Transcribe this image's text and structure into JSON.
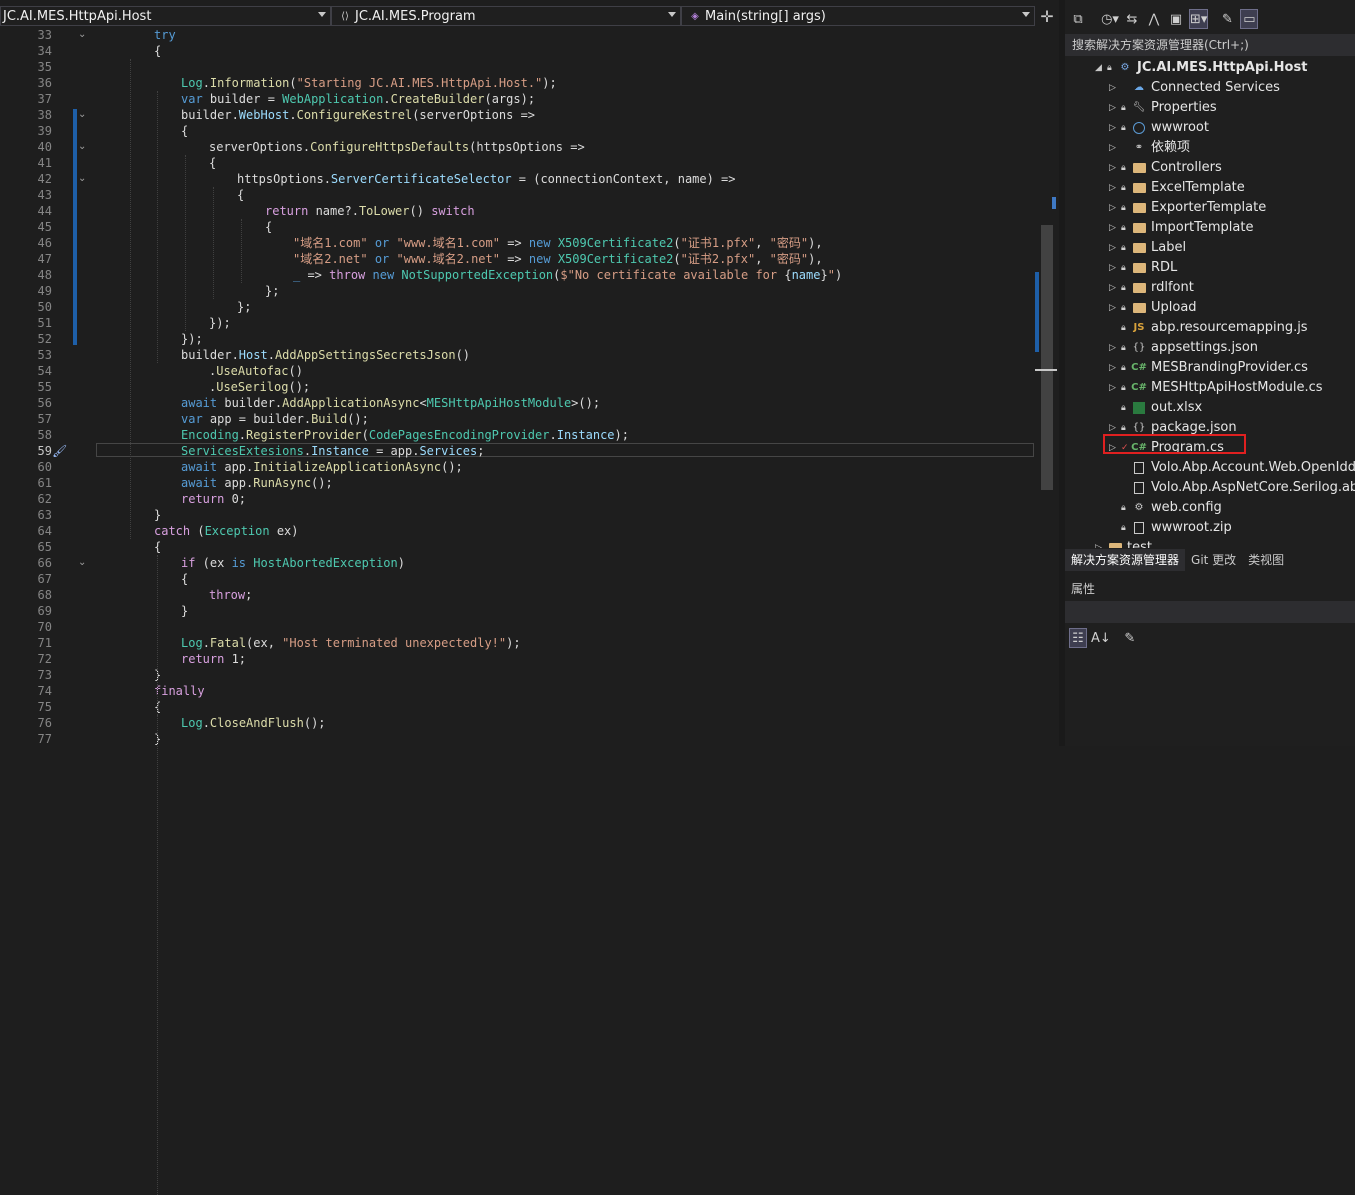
{
  "navbar": {
    "project": "JC.AI.MES.HttpApi.Host",
    "type": "JC.AI.MES.Program",
    "member": "Main(string[] args)",
    "type_icon": "class-icon",
    "member_icon": "method-icon"
  },
  "editor": {
    "current_line": 59,
    "lines": [
      {
        "n": 33,
        "t": [
          [
            "kw",
            "try"
          ]
        ],
        "ind": 54,
        "fold": "v"
      },
      {
        "n": 34,
        "t": [
          [
            "",
            "{"
          ]
        ],
        "ind": 54
      },
      {
        "n": 35,
        "t": [
          [
            "",
            ""
          ]
        ],
        "ind": 54
      },
      {
        "n": 36,
        "t": [
          [
            "ty",
            "Log"
          ],
          [
            "",
            "."
          ],
          [
            "mt",
            "Information"
          ],
          [
            "",
            "("
          ],
          [
            "st",
            "\"Starting JC.AI.MES.HttpApi.Host.\""
          ],
          [
            "",
            ");"
          ]
        ],
        "ind": 81
      },
      {
        "n": 37,
        "t": [
          [
            "kw",
            "var"
          ],
          [
            "",
            " builder = "
          ],
          [
            "ty",
            "WebApplication"
          ],
          [
            "",
            "."
          ],
          [
            "mt",
            "CreateBuilder"
          ],
          [
            "",
            "(args);"
          ]
        ],
        "ind": 81
      },
      {
        "n": 38,
        "t": [
          [
            "",
            "builder."
          ],
          [
            "pr",
            "WebHost"
          ],
          [
            "",
            "."
          ],
          [
            "mt",
            "ConfigureKestrel"
          ],
          [
            "",
            "(serverOptions =>"
          ]
        ],
        "ind": 81,
        "fold": "v"
      },
      {
        "n": 39,
        "t": [
          [
            "",
            "{"
          ]
        ],
        "ind": 81
      },
      {
        "n": 40,
        "t": [
          [
            "",
            "serverOptions."
          ],
          [
            "mt",
            "ConfigureHttpsDefaults"
          ],
          [
            "",
            "(httpsOptions =>"
          ]
        ],
        "ind": 109,
        "fold": "v"
      },
      {
        "n": 41,
        "t": [
          [
            "",
            "{"
          ]
        ],
        "ind": 109
      },
      {
        "n": 42,
        "t": [
          [
            "",
            "httpsOptions."
          ],
          [
            "pr",
            "ServerCertificateSelector"
          ],
          [
            "",
            " = (connectionContext, name) =>"
          ]
        ],
        "ind": 137,
        "fold": "v"
      },
      {
        "n": 43,
        "t": [
          [
            "",
            "{"
          ]
        ],
        "ind": 137
      },
      {
        "n": 44,
        "t": [
          [
            "pl",
            "return"
          ],
          [
            "",
            " name?."
          ],
          [
            "mt",
            "ToLower"
          ],
          [
            "",
            "() "
          ],
          [
            "pl",
            "switch"
          ]
        ],
        "ind": 165
      },
      {
        "n": 45,
        "t": [
          [
            "",
            "{"
          ]
        ],
        "ind": 165
      },
      {
        "n": 46,
        "t": [
          [
            "st",
            "\"域名1.com\""
          ],
          [
            "",
            " "
          ],
          [
            "kw",
            "or"
          ],
          [
            "",
            " "
          ],
          [
            "st",
            "\"www.域名1.com\""
          ],
          [
            "",
            " => "
          ],
          [
            "kw",
            "new"
          ],
          [
            "",
            " "
          ],
          [
            "ty",
            "X509Certificate2"
          ],
          [
            "",
            "("
          ],
          [
            "st",
            "\"证书1.pfx\""
          ],
          [
            "",
            ", "
          ],
          [
            "st",
            "\"密码\""
          ],
          [
            "",
            "),"
          ]
        ],
        "ind": 193
      },
      {
        "n": 47,
        "t": [
          [
            "st",
            "\"域名2.net\""
          ],
          [
            "",
            " "
          ],
          [
            "kw",
            "or"
          ],
          [
            "",
            " "
          ],
          [
            "st",
            "\"www.域名2.net\""
          ],
          [
            "",
            " => "
          ],
          [
            "kw",
            "new"
          ],
          [
            "",
            " "
          ],
          [
            "ty",
            "X509Certificate2"
          ],
          [
            "",
            "("
          ],
          [
            "st",
            "\"证书2.pfx\""
          ],
          [
            "",
            ", "
          ],
          [
            "st",
            "\"密码\""
          ],
          [
            "",
            "),"
          ]
        ],
        "ind": 193
      },
      {
        "n": 48,
        "t": [
          [
            "kw",
            "_"
          ],
          [
            "",
            " => "
          ],
          [
            "pl",
            "throw"
          ],
          [
            "",
            " "
          ],
          [
            "kw",
            "new"
          ],
          [
            "",
            " "
          ],
          [
            "ty",
            "NotSupportedException"
          ],
          [
            "",
            "("
          ],
          [
            "st",
            "$\"No certificate available for "
          ],
          [
            "",
            "{"
          ],
          [
            "pr",
            "name"
          ],
          [
            "",
            "}"
          ],
          [
            "st",
            "\""
          ],
          [
            "",
            ")"
          ]
        ],
        "ind": 193
      },
      {
        "n": 49,
        "t": [
          [
            "",
            "};"
          ]
        ],
        "ind": 165
      },
      {
        "n": 50,
        "t": [
          [
            "",
            "};"
          ]
        ],
        "ind": 137
      },
      {
        "n": 51,
        "t": [
          [
            "",
            "});"
          ]
        ],
        "ind": 109
      },
      {
        "n": 52,
        "t": [
          [
            "",
            "});"
          ]
        ],
        "ind": 81
      },
      {
        "n": 53,
        "t": [
          [
            "",
            "builder."
          ],
          [
            "pr",
            "Host"
          ],
          [
            "",
            "."
          ],
          [
            "mt",
            "AddAppSettingsSecretsJson"
          ],
          [
            "",
            "()"
          ]
        ],
        "ind": 81
      },
      {
        "n": 54,
        "t": [
          [
            "",
            "."
          ],
          [
            "mt",
            "UseAutofac"
          ],
          [
            "",
            "()"
          ]
        ],
        "ind": 109
      },
      {
        "n": 55,
        "t": [
          [
            "",
            "."
          ],
          [
            "mt",
            "UseSerilog"
          ],
          [
            "",
            "();"
          ]
        ],
        "ind": 109
      },
      {
        "n": 56,
        "t": [
          [
            "kw",
            "await"
          ],
          [
            "",
            " builder."
          ],
          [
            "mt",
            "AddApplicationAsync"
          ],
          [
            "",
            "<"
          ],
          [
            "ty",
            "MESHttpApiHostModule"
          ],
          [
            "",
            ">();"
          ]
        ],
        "ind": 81
      },
      {
        "n": 57,
        "t": [
          [
            "kw",
            "var"
          ],
          [
            "",
            " app = builder."
          ],
          [
            "mt",
            "Build"
          ],
          [
            "",
            "();"
          ]
        ],
        "ind": 81
      },
      {
        "n": 58,
        "t": [
          [
            "ty",
            "Encoding"
          ],
          [
            "",
            "."
          ],
          [
            "mt",
            "RegisterProvider"
          ],
          [
            "",
            "("
          ],
          [
            "ty",
            "CodePagesEncodingProvider"
          ],
          [
            "",
            "."
          ],
          [
            "pr",
            "Instance"
          ],
          [
            "",
            ");"
          ]
        ],
        "ind": 81
      },
      {
        "n": 59,
        "t": [
          [
            "ty",
            "ServicesExtesions"
          ],
          [
            "",
            "."
          ],
          [
            "pr",
            "Instance"
          ],
          [
            "",
            " = app."
          ],
          [
            "pr",
            "Services"
          ],
          [
            "",
            ";"
          ]
        ],
        "ind": 81
      },
      {
        "n": 60,
        "t": [
          [
            "kw",
            "await"
          ],
          [
            "",
            " app."
          ],
          [
            "mt",
            "InitializeApplicationAsync"
          ],
          [
            "",
            "();"
          ]
        ],
        "ind": 81
      },
      {
        "n": 61,
        "t": [
          [
            "kw",
            "await"
          ],
          [
            "",
            " app."
          ],
          [
            "mt",
            "RunAsync"
          ],
          [
            "",
            "();"
          ]
        ],
        "ind": 81
      },
      {
        "n": 62,
        "t": [
          [
            "pl",
            "return"
          ],
          [
            "",
            " 0;"
          ]
        ],
        "ind": 81
      },
      {
        "n": 63,
        "t": [
          [
            "",
            "}"
          ]
        ],
        "ind": 54
      },
      {
        "n": 64,
        "t": [
          [
            "pl",
            "catch"
          ],
          [
            "",
            " ("
          ],
          [
            "ty",
            "Exception"
          ],
          [
            "",
            " ex)"
          ]
        ],
        "ind": 54
      },
      {
        "n": 65,
        "t": [
          [
            "",
            "{"
          ]
        ],
        "ind": 54
      },
      {
        "n": 66,
        "t": [
          [
            "pl",
            "if"
          ],
          [
            "",
            " (ex "
          ],
          [
            "kw",
            "is"
          ],
          [
            "",
            " "
          ],
          [
            "ty",
            "HostAbortedException"
          ],
          [
            "",
            ")"
          ]
        ],
        "ind": 81,
        "fold": "v"
      },
      {
        "n": 67,
        "t": [
          [
            "",
            "{"
          ]
        ],
        "ind": 81
      },
      {
        "n": 68,
        "t": [
          [
            "pl",
            "throw"
          ],
          [
            "",
            ";"
          ]
        ],
        "ind": 109
      },
      {
        "n": 69,
        "t": [
          [
            "",
            "}"
          ]
        ],
        "ind": 81
      },
      {
        "n": 70,
        "t": [
          [
            "",
            ""
          ]
        ],
        "ind": 81
      },
      {
        "n": 71,
        "t": [
          [
            "ty",
            "Log"
          ],
          [
            "",
            "."
          ],
          [
            "mt",
            "Fatal"
          ],
          [
            "",
            "(ex, "
          ],
          [
            "st",
            "\"Host terminated unexpectedly!\""
          ],
          [
            "",
            ");"
          ]
        ],
        "ind": 81
      },
      {
        "n": 72,
        "t": [
          [
            "pl",
            "return"
          ],
          [
            "",
            " 1;"
          ]
        ],
        "ind": 81
      },
      {
        "n": 73,
        "t": [
          [
            "",
            "}"
          ]
        ],
        "ind": 54
      },
      {
        "n": 74,
        "t": [
          [
            "pl",
            "finally"
          ]
        ],
        "ind": 54
      },
      {
        "n": 75,
        "t": [
          [
            "",
            "{"
          ]
        ],
        "ind": 54
      },
      {
        "n": 76,
        "t": [
          [
            "ty",
            "Log"
          ],
          [
            "",
            "."
          ],
          [
            "mt",
            "CloseAndFlush"
          ],
          [
            "",
            "();"
          ]
        ],
        "ind": 81
      },
      {
        "n": 77,
        "t": [
          [
            "",
            "}"
          ]
        ],
        "ind": 54
      }
    ]
  },
  "solution_explorer": {
    "search_placeholder": "搜索解决方案资源管理器(Ctrl+;)",
    "project": "JC.AI.MES.HttpApi.Host",
    "items": [
      {
        "label": "Connected Services",
        "icon": "connected-services-icon",
        "exp": true,
        "lock": false
      },
      {
        "label": "Properties",
        "icon": "properties-icon",
        "exp": true,
        "lock": true
      },
      {
        "label": "wwwroot",
        "icon": "globe-icon",
        "exp": true,
        "lock": true
      },
      {
        "label": "依赖项",
        "icon": "dependencies-icon",
        "exp": true,
        "lock": false
      },
      {
        "label": "Controllers",
        "icon": "folder-icon",
        "exp": true,
        "lock": true
      },
      {
        "label": "ExcelTemplate",
        "icon": "folder-icon",
        "exp": true,
        "lock": true
      },
      {
        "label": "ExporterTemplate",
        "icon": "folder-icon",
        "exp": true,
        "lock": true
      },
      {
        "label": "ImportTemplate",
        "icon": "folder-icon",
        "exp": true,
        "lock": true
      },
      {
        "label": "Label",
        "icon": "folder-icon",
        "exp": true,
        "lock": true
      },
      {
        "label": "RDL",
        "icon": "folder-icon",
        "exp": true,
        "lock": true
      },
      {
        "label": "rdlfont",
        "icon": "folder-icon",
        "exp": true,
        "lock": true
      },
      {
        "label": "Upload",
        "icon": "folder-icon",
        "exp": true,
        "lock": true
      },
      {
        "label": "abp.resourcemapping.js",
        "icon": "js-file-icon",
        "exp": false,
        "lock": true
      },
      {
        "label": "appsettings.json",
        "icon": "json-file-icon",
        "exp": true,
        "lock": true
      },
      {
        "label": "MESBrandingProvider.cs",
        "icon": "csharp-file-icon",
        "exp": true,
        "lock": true
      },
      {
        "label": "MESHttpApiHostModule.cs",
        "icon": "csharp-file-icon",
        "exp": true,
        "lock": true
      },
      {
        "label": "out.xlsx",
        "icon": "excel-file-icon",
        "exp": false,
        "lock": true
      },
      {
        "label": "package.json",
        "icon": "json-file-icon",
        "exp": true,
        "lock": true
      },
      {
        "label": "Program.cs",
        "icon": "csharp-file-icon",
        "exp": true,
        "lock": false,
        "check": true,
        "selected": true
      },
      {
        "label": "Volo.Abp.Account.Web.OpenIddict",
        "icon": "file-icon",
        "exp": false,
        "lock": false
      },
      {
        "label": "Volo.Abp.AspNetCore.Serilog.abp",
        "icon": "file-icon",
        "exp": false,
        "lock": false
      },
      {
        "label": "web.config",
        "icon": "config-file-icon",
        "exp": false,
        "lock": true
      },
      {
        "label": "wwwroot.zip",
        "icon": "file-icon",
        "exp": false,
        "lock": true
      }
    ],
    "partial_item": "test",
    "tabs": [
      "解决方案资源管理器",
      "Git 更改",
      "类视图"
    ],
    "properties_title": "属性"
  }
}
